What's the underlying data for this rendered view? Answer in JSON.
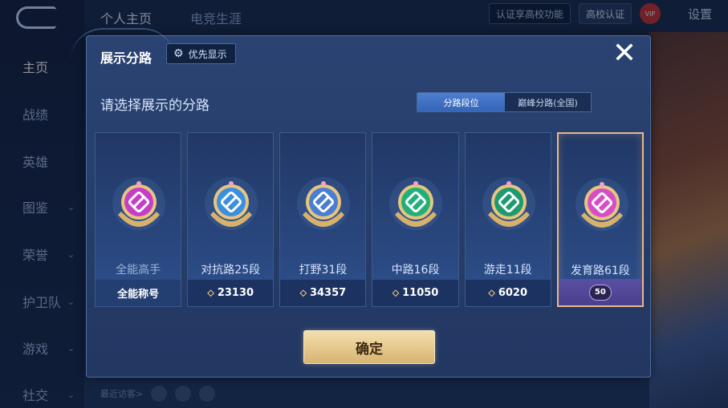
{
  "nav": {
    "items": [
      {
        "label": "主页",
        "active": true,
        "chevron": false
      },
      {
        "label": "战绩",
        "active": false,
        "chevron": false
      },
      {
        "label": "英雄",
        "active": false,
        "chevron": false
      },
      {
        "label": "图鉴",
        "active": false,
        "chevron": true
      },
      {
        "label": "荣誉",
        "active": false,
        "chevron": true
      },
      {
        "label": "护卫队",
        "active": false,
        "chevron": true
      },
      {
        "label": "游戏",
        "active": false,
        "chevron": true
      },
      {
        "label": "社交",
        "active": false,
        "chevron": true
      }
    ],
    "chevron_glyph": "⌄"
  },
  "header": {
    "tabs": [
      "个人主页",
      "电竞生涯"
    ],
    "auth_button": "认证享高校功能",
    "cert_button": "高校认证",
    "settings": "设置"
  },
  "bottom": {
    "recent_label": "最近访客>"
  },
  "modal": {
    "title": "展示分路",
    "priority_button": "优先显示",
    "close_glyph": "✕",
    "subtitle": "请选择展示的分路",
    "toggle": {
      "tab1": "分路段位",
      "tab2": "巅峰分路(全国)",
      "active": "tab1"
    },
    "confirm": "确定",
    "cards": [
      {
        "name": "全能高手",
        "foot": "全能称号",
        "icon": "allround-emblem",
        "color": "#c43ec7",
        "selected": false,
        "muted": true
      },
      {
        "name": "对抗路25段",
        "foot": "23130",
        "icon": "clash-lane-emblem",
        "color": "#3b8fe0",
        "selected": false,
        "muted": false
      },
      {
        "name": "打野31段",
        "foot": "34357",
        "icon": "jungle-emblem",
        "color": "#4a7ed4",
        "selected": false,
        "muted": false
      },
      {
        "name": "中路16段",
        "foot": "11050",
        "icon": "mid-lane-emblem",
        "color": "#22b07a",
        "selected": false,
        "muted": false
      },
      {
        "name": "游走11段",
        "foot": "6020",
        "icon": "roam-emblem",
        "color": "#1e9a70",
        "selected": false,
        "muted": false
      },
      {
        "name": "发育路61段",
        "foot": "50",
        "icon": "farm-lane-emblem",
        "color": "#d64ec7",
        "selected": true,
        "muted": false
      }
    ]
  },
  "colors": {
    "accent": "#3465b7",
    "confirm": "#e5c98b",
    "selected_border": "#e8b98a"
  }
}
